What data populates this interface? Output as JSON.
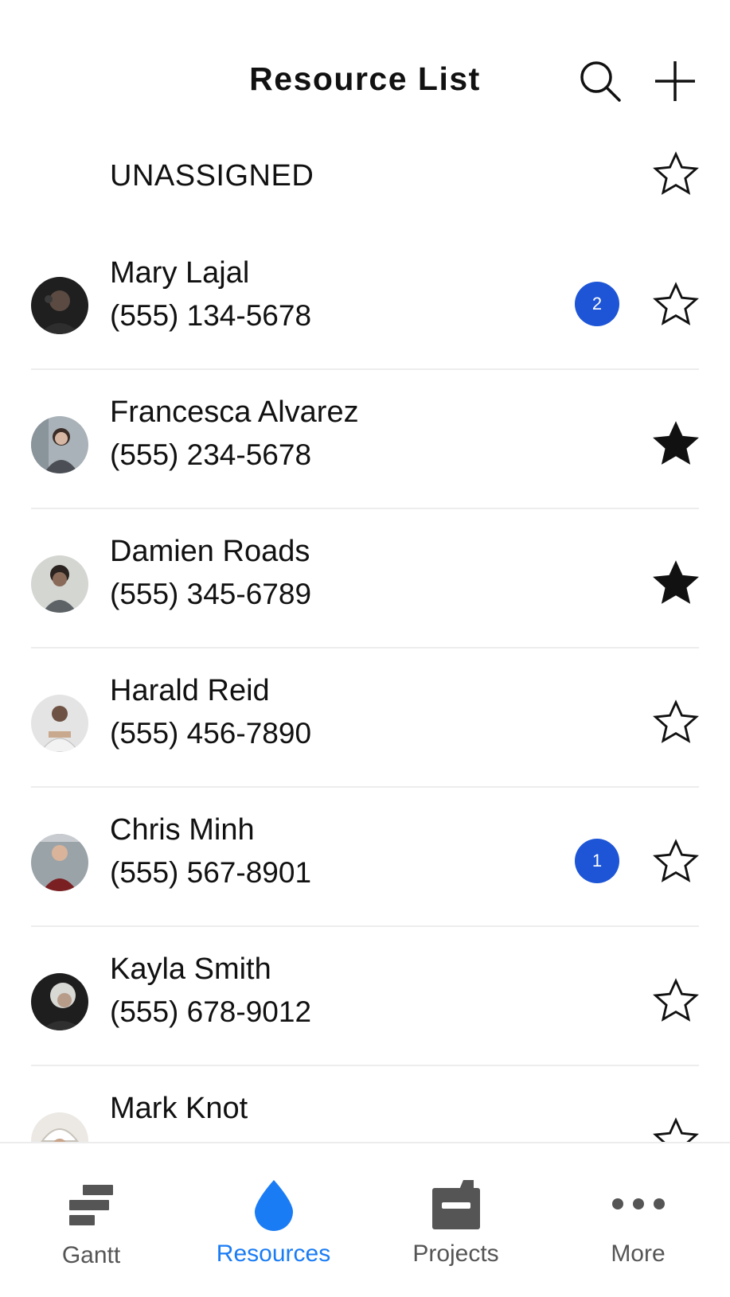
{
  "header": {
    "title": "Resource List",
    "search_icon": "search-icon",
    "add_icon": "plus-icon"
  },
  "unassigned": {
    "label": "UNASSIGNED",
    "favorite": false
  },
  "resources": [
    {
      "name": "Mary Lajal",
      "phone": "(555) 134-5678",
      "badge": "2",
      "favorite": false,
      "avatar_color": "#2b2b2b"
    },
    {
      "name": "Francesca Alvarez",
      "phone": "(555) 234-5678",
      "badge": null,
      "favorite": true,
      "avatar_color": "#7a8590"
    },
    {
      "name": "Damien Roads",
      "phone": "(555) 345-6789",
      "badge": null,
      "favorite": true,
      "avatar_color": "#c9cdc8"
    },
    {
      "name": "Harald Reid",
      "phone": "(555) 456-7890",
      "badge": null,
      "favorite": false,
      "avatar_color": "#d8d8d8"
    },
    {
      "name": "Chris Minh",
      "phone": "(555) 567-8901",
      "badge": "1",
      "favorite": false,
      "avatar_color": "#8a6a5e"
    },
    {
      "name": "Kayla Smith",
      "phone": "(555) 678-9012",
      "badge": null,
      "favorite": false,
      "avatar_color": "#3a3a3a"
    },
    {
      "name": "Mark Knot",
      "phone": "",
      "badge": null,
      "favorite": false,
      "avatar_color": "#e6e2dc"
    }
  ],
  "tabbar": {
    "tabs": [
      {
        "label": "Gantt",
        "icon": "gantt-icon",
        "active": false
      },
      {
        "label": "Resources",
        "icon": "resources-drop-icon",
        "active": true
      },
      {
        "label": "Projects",
        "icon": "projects-folder-icon",
        "active": false
      },
      {
        "label": "More",
        "icon": "more-dots-icon",
        "active": false
      }
    ]
  },
  "colors": {
    "accent": "#1a7cf5",
    "badge": "#1d55d6",
    "tab_inactive": "#555555",
    "divider": "#ededed"
  }
}
